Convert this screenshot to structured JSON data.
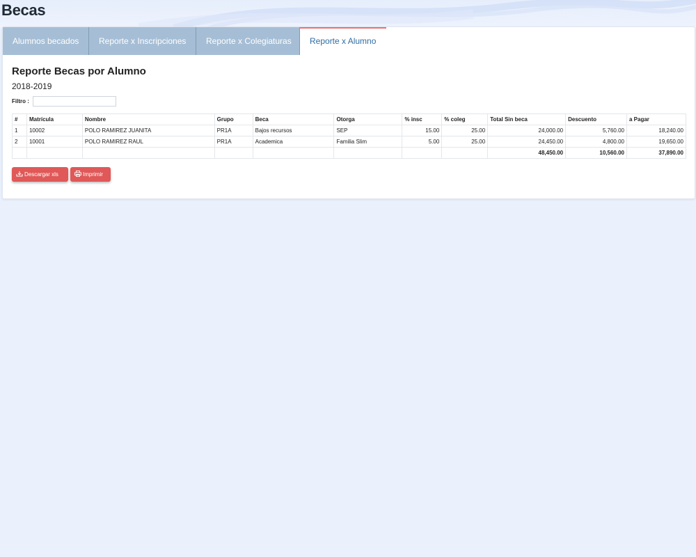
{
  "page": {
    "title": "Becas"
  },
  "tabs": [
    {
      "label": "Alumnos becados"
    },
    {
      "label": "Reporte x Inscripciones"
    },
    {
      "label": "Reporte x Colegiaturas"
    },
    {
      "label": "Reporte x Alumno",
      "active": true
    }
  ],
  "report": {
    "title": "Reporte Becas por Alumno",
    "period": "2018-2019",
    "filter_label": "Filtro :",
    "filter_value": ""
  },
  "table": {
    "headers": [
      "#",
      "Matrícula",
      "Nombre",
      "Grupo",
      "Beca",
      "Otorga",
      "% insc",
      "% coleg",
      "Total Sin beca",
      "Descuento",
      "a Pagar"
    ],
    "rows": [
      [
        "1",
        "10002",
        "POLO RAMIREZ JUANITA",
        "PR1A",
        "Bajos recursos",
        "SEP",
        "15.00",
        "25.00",
        "24,000.00",
        "5,760.00",
        "18,240.00"
      ],
      [
        "2",
        "10001",
        "POLO RAMIREZ RAUL",
        "PR1A",
        "Academica",
        "Familia Slim",
        "5.00",
        "25.00",
        "24,450.00",
        "4,800.00",
        "19,650.00"
      ]
    ],
    "totals": [
      "",
      "",
      "",
      "",
      "",
      "",
      "",
      "",
      "48,450.00",
      "10,560.00",
      "37,890.00"
    ]
  },
  "actions": {
    "download_label": "Descargar xls",
    "download_icon": "download-icon",
    "print_label": "Imprimir",
    "print_icon": "printer-icon"
  },
  "colors": {
    "accent_red": "#e05858",
    "tab_inactive": "#a6bed5",
    "tab_active_text": "#2e6da4",
    "page_bg": "#eaf1fd"
  }
}
